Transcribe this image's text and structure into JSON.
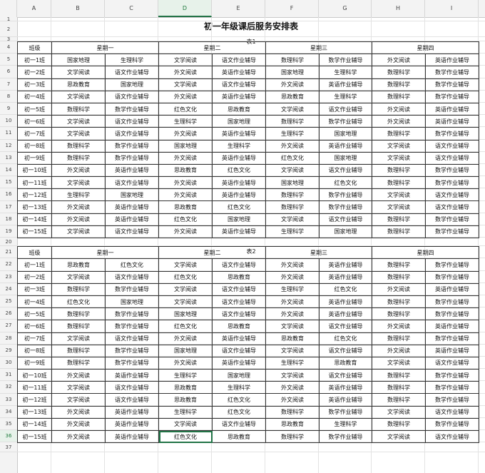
{
  "columns": [
    "A",
    "B",
    "C",
    "D",
    "E",
    "F",
    "G",
    "H",
    "I"
  ],
  "active_column": "D",
  "active_row": 36,
  "title": "初一年级课后服务安排表",
  "table1": {
    "caption": "表1",
    "header": [
      "班级",
      "星期一",
      "星期二",
      "星期三",
      "星期四"
    ],
    "rows": [
      [
        "初一1班",
        "国家地理",
        "生理科学",
        "文学阅读",
        "语文作业辅导",
        "数理科学",
        "数学作业辅导",
        "外文阅读",
        "英语作业辅导"
      ],
      [
        "初一2班",
        "文学阅读",
        "语文作业辅导",
        "外文阅读",
        "英语作业辅导",
        "国家地理",
        "生理科学",
        "数理科学",
        "数学作业辅导"
      ],
      [
        "初一3班",
        "思政教育",
        "国家地理",
        "文学阅读",
        "语文作业辅导",
        "外文阅读",
        "英语作业辅导",
        "数理科学",
        "数学作业辅导"
      ],
      [
        "初一4班",
        "文学阅读",
        "语文作业辅导",
        "外文阅读",
        "英语作业辅导",
        "思政教育",
        "生理科学",
        "数理科学",
        "数学作业辅导"
      ],
      [
        "初一5班",
        "数理科学",
        "数学作业辅导",
        "红色文化",
        "思政教育",
        "文学阅读",
        "语文作业辅导",
        "外文阅读",
        "英语作业辅导"
      ],
      [
        "初一6班",
        "文学阅读",
        "语文作业辅导",
        "生理科学",
        "国家地理",
        "数理科学",
        "数学作业辅导",
        "外文阅读",
        "英语作业辅导"
      ],
      [
        "初一7班",
        "文学阅读",
        "语文作业辅导",
        "外文阅读",
        "英语作业辅导",
        "生理科学",
        "国家地理",
        "数理科学",
        "数学作业辅导"
      ],
      [
        "初一8班",
        "数理科学",
        "数学作业辅导",
        "国家地理",
        "生理科学",
        "外文阅读",
        "英语作业辅导",
        "文学阅读",
        "语文作业辅导"
      ],
      [
        "初一9班",
        "数理科学",
        "数学作业辅导",
        "外文阅读",
        "英语作业辅导",
        "红色文化",
        "国家地理",
        "文学阅读",
        "语文作业辅导"
      ],
      [
        "初一10班",
        "外文阅读",
        "英语作业辅导",
        "思政教育",
        "红色文化",
        "文学阅读",
        "语文作业辅导",
        "数理科学",
        "数学作业辅导"
      ],
      [
        "初一11班",
        "文学阅读",
        "语文作业辅导",
        "外文阅读",
        "英语作业辅导",
        "国家地理",
        "红色文化",
        "数理科学",
        "数学作业辅导"
      ],
      [
        "初一12班",
        "生理科学",
        "国家地理",
        "外文阅读",
        "英语作业辅导",
        "数理科学",
        "数学作业辅导",
        "文学阅读",
        "语文作业辅导"
      ],
      [
        "初一13班",
        "外文阅读",
        "英语作业辅导",
        "思政教育",
        "红色文化",
        "数理科学",
        "数学作业辅导",
        "文学阅读",
        "语文作业辅导"
      ],
      [
        "初一14班",
        "外文阅读",
        "英语作业辅导",
        "红色文化",
        "国家地理",
        "文学阅读",
        "语文作业辅导",
        "数理科学",
        "数学作业辅导"
      ],
      [
        "初一15班",
        "文学阅读",
        "语文作业辅导",
        "外文阅读",
        "英语作业辅导",
        "生理科学",
        "国家地理",
        "数理科学",
        "数学作业辅导"
      ]
    ]
  },
  "table2": {
    "caption": "表2",
    "header": [
      "班级",
      "星期一",
      "星期二",
      "星期三",
      "星期四"
    ],
    "rows": [
      [
        "初一1班",
        "思政教育",
        "红色文化",
        "文学阅读",
        "语文作业辅导",
        "外文阅读",
        "英语作业辅导",
        "数理科学",
        "数学作业辅导"
      ],
      [
        "初一2班",
        "文学阅读",
        "语文作业辅导",
        "红色文化",
        "思政教育",
        "外文阅读",
        "英语作业辅导",
        "数理科学",
        "数学作业辅导"
      ],
      [
        "初一3班",
        "数理科学",
        "数学作业辅导",
        "文学阅读",
        "语文作业辅导",
        "生理科学",
        "红色文化",
        "外文阅读",
        "英语作业辅导"
      ],
      [
        "初一4班",
        "红色文化",
        "国家地理",
        "文学阅读",
        "语文作业辅导",
        "外文阅读",
        "英语作业辅导",
        "数理科学",
        "数学作业辅导"
      ],
      [
        "初一5班",
        "数理科学",
        "数学作业辅导",
        "国家地理",
        "语文作业辅导",
        "外文阅读",
        "英语作业辅导",
        "数理科学",
        "数学作业辅导"
      ],
      [
        "初一6班",
        "数理科学",
        "数学作业辅导",
        "红色文化",
        "思政教育",
        "文学阅读",
        "语文作业辅导",
        "外文阅读",
        "英语作业辅导"
      ],
      [
        "初一7班",
        "文学阅读",
        "语文作业辅导",
        "外文阅读",
        "英语作业辅导",
        "思政教育",
        "红色文化",
        "数理科学",
        "数学作业辅导"
      ],
      [
        "初一8班",
        "数理科学",
        "数学作业辅导",
        "国家地理",
        "语文作业辅导",
        "文学阅读",
        "语文作业辅导",
        "外文阅读",
        "英语作业辅导"
      ],
      [
        "初一9班",
        "数理科学",
        "数学作业辅导",
        "外文阅读",
        "英语作业辅导",
        "生理科学",
        "思政教育",
        "文学阅读",
        "语文作业辅导"
      ],
      [
        "初一10班",
        "外文阅读",
        "英语作业辅导",
        "生理科学",
        "国家地理",
        "文学阅读",
        "语文作业辅导",
        "数理科学",
        "数学作业辅导"
      ],
      [
        "初一11班",
        "文学阅读",
        "语文作业辅导",
        "思政教育",
        "生理科学",
        "外文阅读",
        "英语作业辅导",
        "数理科学",
        "数学作业辅导"
      ],
      [
        "初一12班",
        "文学阅读",
        "语文作业辅导",
        "思政教育",
        "红色文化",
        "外文阅读",
        "英语作业辅导",
        "数理科学",
        "数学作业辅导"
      ],
      [
        "初一13班",
        "外文阅读",
        "英语作业辅导",
        "生理科学",
        "红色文化",
        "数理科学",
        "数学作业辅导",
        "文学阅读",
        "语文作业辅导"
      ],
      [
        "初一14班",
        "外文阅读",
        "英语作业辅导",
        "文学阅读",
        "语文作业辅导",
        "思政教育",
        "生理科学",
        "数理科学",
        "数学作业辅导"
      ],
      [
        "初一15班",
        "外文阅读",
        "英语作业辅导",
        "红色文化",
        "思政教育",
        "数理科学",
        "数学作业辅导",
        "文学阅读",
        "语文作业辅导"
      ]
    ]
  }
}
